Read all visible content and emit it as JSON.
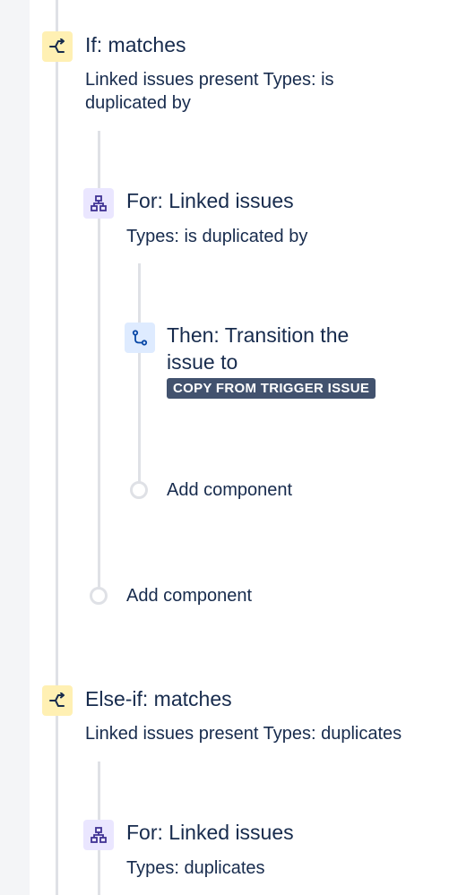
{
  "blocks": {
    "if_condition": {
      "title": "If: matches",
      "description": "Linked issues present Types: is duplicated by",
      "icon": "condition-branch-icon"
    },
    "for_linked_1": {
      "title": "For: Linked issues",
      "description": "Types: is duplicated by",
      "icon": "hierarchy-icon"
    },
    "then_action": {
      "title": "Then: Transition the issue to",
      "lozenge": "COPY FROM TRIGGER ISSUE",
      "icon": "transition-icon"
    },
    "add_component_inner": {
      "label": "Add component"
    },
    "add_component_outer": {
      "label": "Add component"
    },
    "elseif_condition": {
      "title": "Else-if: matches",
      "description": "Linked issues present Types: duplicates",
      "icon": "condition-branch-icon"
    },
    "for_linked_2": {
      "title": "For: Linked issues",
      "description": "Types: duplicates",
      "icon": "hierarchy-icon"
    }
  },
  "colors": {
    "condition_bg": "#FFF0B3",
    "branch_bg": "#EAE6FF",
    "action_bg": "#DEEBFF",
    "lozenge_bg": "#42526E",
    "line": "#DFE1E6",
    "text": "#172B4D"
  }
}
